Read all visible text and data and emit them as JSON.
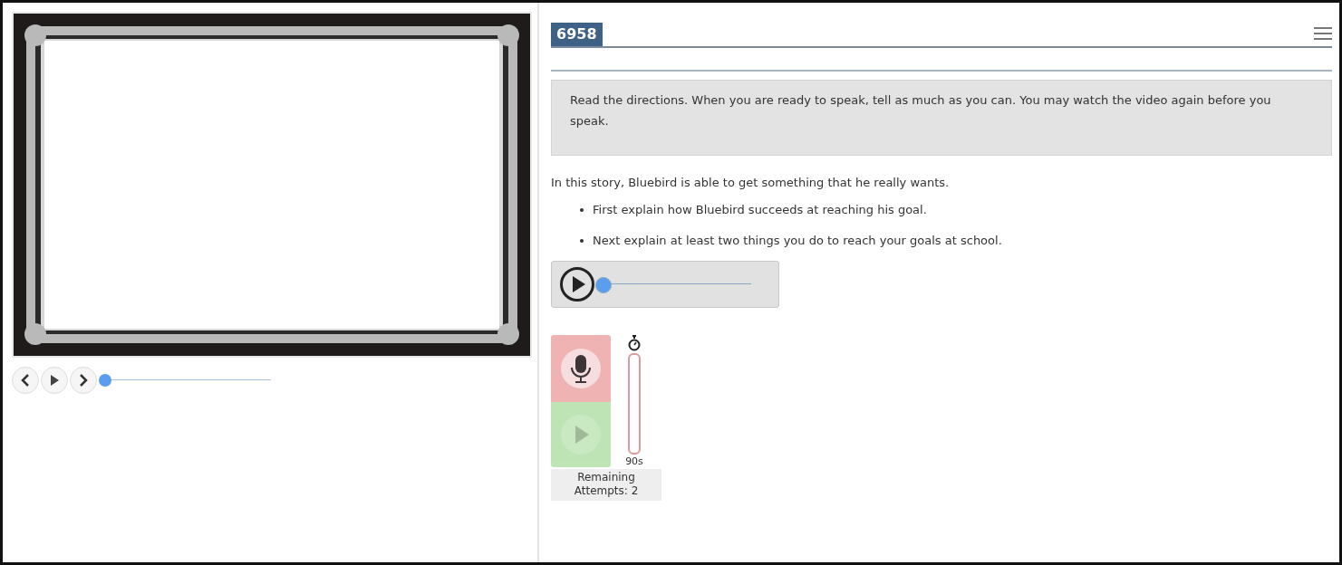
{
  "video": {
    "kind": "picture",
    "seek": {
      "level": 0
    }
  },
  "item": {
    "number": "6958",
    "directions": "Read the directions. When you are ready to speak, tell as much as you can. You may watch the video again before you speak.",
    "prompt": "In this story, Bluebird is able to get something that he really wants.",
    "bullets": [
      "First explain how Bluebird succeeds at reaching his goal.",
      "Next explain at least two things you do to reach your goals at school."
    ],
    "audio_player": {
      "level": 0
    },
    "recorder": {
      "playback_disabled": true,
      "timer": {
        "level": 0
      },
      "timer_label": "90s",
      "attempts": "Remaining Attempts: 2"
    }
  }
}
